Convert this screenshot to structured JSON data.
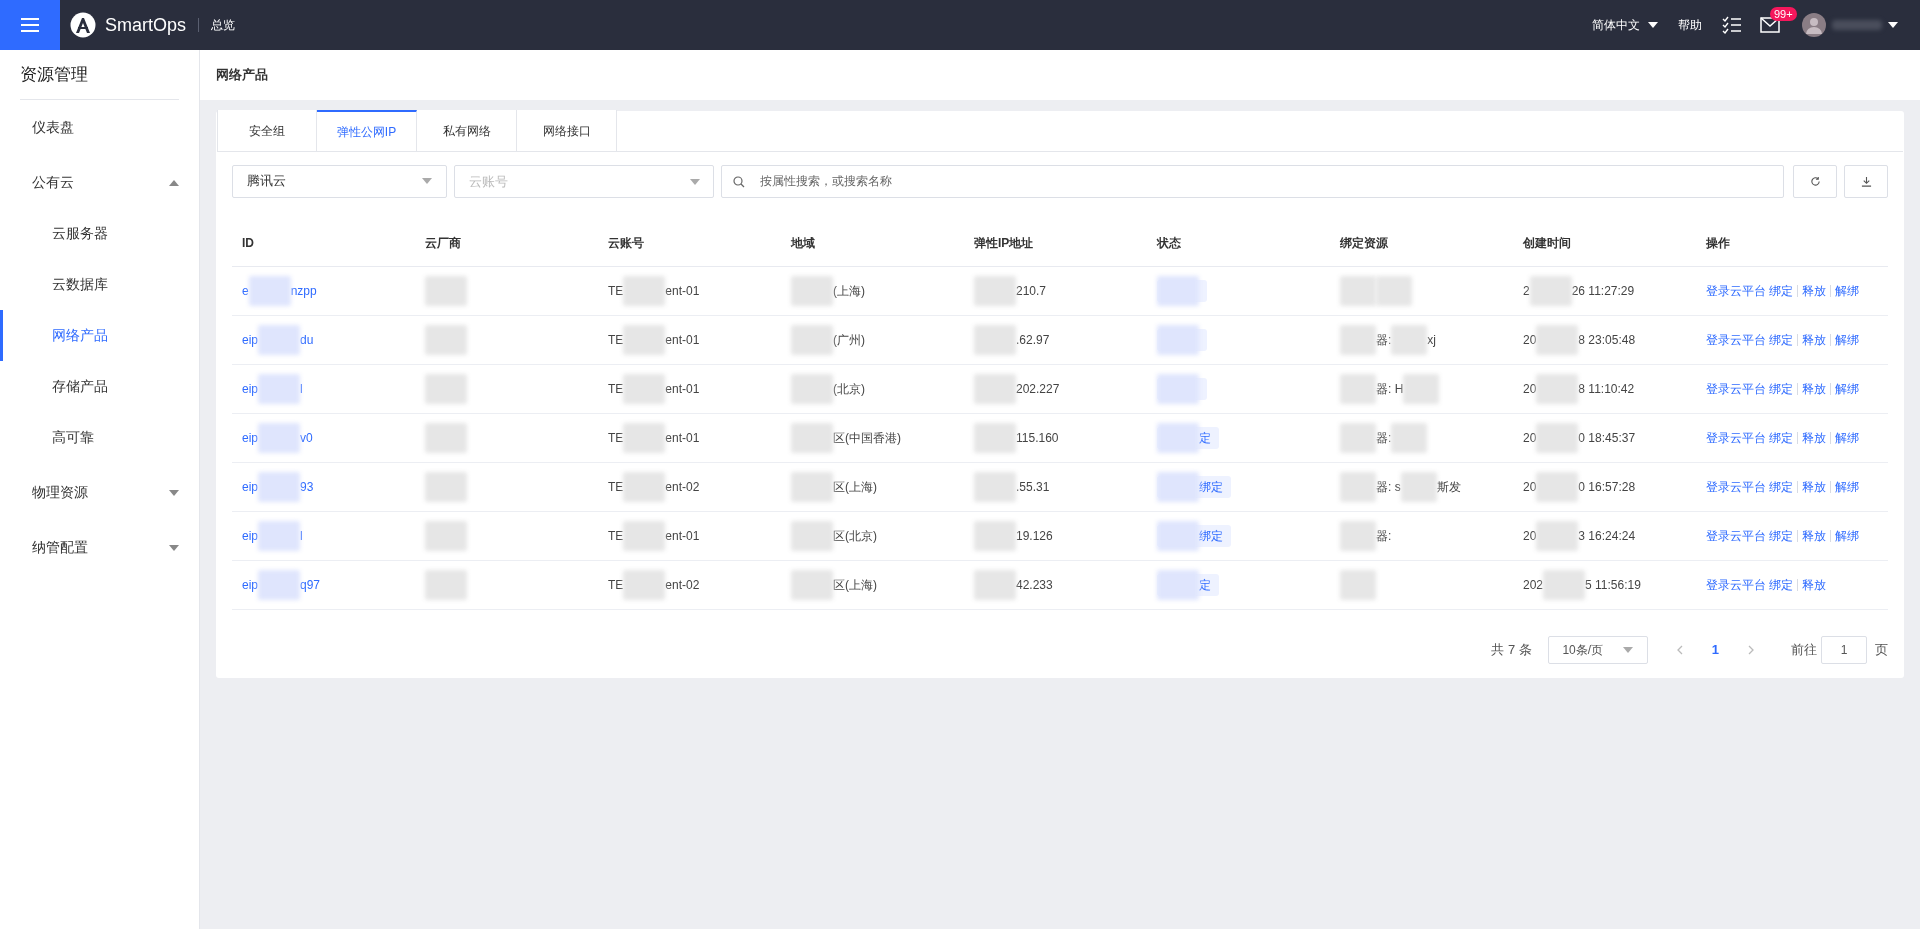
{
  "top_bar": {
    "app_name": "SmartOps",
    "nav": "总览",
    "language": "简体中文",
    "help": "帮助",
    "notification_count": "99+"
  },
  "sidebar": {
    "title": "资源管理",
    "items": [
      {
        "label": "仪表盘",
        "selected": false
      },
      {
        "label": "公有云",
        "selected": false,
        "expanded": true,
        "children": [
          {
            "label": "云服务器",
            "selected": false
          },
          {
            "label": "云数据库",
            "selected": false
          },
          {
            "label": "网络产品",
            "selected": true
          },
          {
            "label": "存储产品",
            "selected": false
          },
          {
            "label": "高可靠",
            "selected": false
          }
        ]
      },
      {
        "label": "物理资源",
        "selected": false,
        "expanded": false
      },
      {
        "label": "纳管配置",
        "selected": false,
        "expanded": false
      }
    ]
  },
  "page_title": "网络产品",
  "tabs": [
    {
      "label": "安全组",
      "selected": false
    },
    {
      "label": "弹性公网IP",
      "selected": true
    },
    {
      "label": "私有网络",
      "selected": false
    },
    {
      "label": "网络接口",
      "selected": false
    }
  ],
  "filters": {
    "vendor": {
      "value": "腾讯云"
    },
    "account": {
      "placeholder": "云账号"
    },
    "search": {
      "placeholder": "按属性搜索，或搜索名称"
    }
  },
  "table": {
    "columns": [
      "ID",
      "云厂商",
      "云账号",
      "地域",
      "弹性IP地址",
      "状态",
      "绑定资源",
      "创建时间",
      "操作"
    ],
    "rows": [
      {
        "cells": [
          [
            {
              "kind": "text",
              "text": "e"
            },
            {
              "kind": "blur"
            },
            {
              "kind": "text",
              "text": "nzpp"
            }
          ],
          [
            {
              "kind": "blur"
            }
          ],
          [
            {
              "kind": "text",
              "text": "TE"
            },
            {
              "kind": "blur"
            },
            {
              "kind": "text",
              "text": "ent-01"
            }
          ],
          [
            {
              "kind": "blur"
            },
            {
              "kind": "text",
              "text": "(上海)"
            }
          ],
          [
            {
              "kind": "blur"
            },
            {
              "kind": "text",
              "text": "210.7"
            }
          ],
          [
            {
              "kind": "blur"
            }
          ],
          [
            {
              "kind": "blur"
            },
            {
              "kind": "blur"
            }
          ],
          [
            {
              "kind": "text",
              "text": "2"
            },
            {
              "kind": "blur"
            },
            {
              "kind": "text",
              "text": "26 11:27:29"
            }
          ]
        ],
        "actions": [
          "登录云平台",
          "绑定",
          "释放",
          "解绑"
        ]
      },
      {
        "cells": [
          [
            {
              "kind": "text",
              "text": "eip"
            },
            {
              "kind": "blur"
            },
            {
              "kind": "text",
              "text": "du"
            }
          ],
          [
            {
              "kind": "blur"
            }
          ],
          [
            {
              "kind": "text",
              "text": "TE"
            },
            {
              "kind": "blur"
            },
            {
              "kind": "text",
              "text": "ent-01"
            }
          ],
          [
            {
              "kind": "blur"
            },
            {
              "kind": "text",
              "text": "(广州)"
            }
          ],
          [
            {
              "kind": "blur"
            },
            {
              "kind": "text",
              "text": ".62.97"
            }
          ],
          [
            {
              "kind": "blur"
            }
          ],
          [
            {
              "kind": "blur"
            },
            {
              "kind": "text",
              "text": "器:"
            },
            {
              "kind": "blur"
            },
            {
              "kind": "text",
              "text": "xj"
            }
          ],
          [
            {
              "kind": "text",
              "text": "20"
            },
            {
              "kind": "blur"
            },
            {
              "kind": "text",
              "text": "8 23:05:48"
            }
          ]
        ],
        "actions": [
          "登录云平台",
          "绑定",
          "释放",
          "解绑"
        ]
      },
      {
        "cells": [
          [
            {
              "kind": "text",
              "text": "eip"
            },
            {
              "kind": "blur"
            },
            {
              "kind": "text",
              "text": "l"
            }
          ],
          [
            {
              "kind": "blur"
            }
          ],
          [
            {
              "kind": "text",
              "text": "TE"
            },
            {
              "kind": "blur"
            },
            {
              "kind": "text",
              "text": "ent-01"
            }
          ],
          [
            {
              "kind": "blur"
            },
            {
              "kind": "text",
              "text": "(北京)"
            }
          ],
          [
            {
              "kind": "blur"
            },
            {
              "kind": "text",
              "text": "202.227"
            }
          ],
          [
            {
              "kind": "blur"
            }
          ],
          [
            {
              "kind": "blur"
            },
            {
              "kind": "text",
              "text": "器: H"
            },
            {
              "kind": "blur"
            }
          ],
          [
            {
              "kind": "text",
              "text": "20"
            },
            {
              "kind": "blur"
            },
            {
              "kind": "text",
              "text": "8 11:10:42"
            }
          ]
        ],
        "actions": [
          "登录云平台",
          "绑定",
          "释放",
          "解绑"
        ]
      },
      {
        "cells": [
          [
            {
              "kind": "text",
              "text": "eip"
            },
            {
              "kind": "blur"
            },
            {
              "kind": "text",
              "text": "v0"
            }
          ],
          [
            {
              "kind": "blur"
            }
          ],
          [
            {
              "kind": "text",
              "text": "TE"
            },
            {
              "kind": "blur"
            },
            {
              "kind": "text",
              "text": "ent-01"
            }
          ],
          [
            {
              "kind": "blur"
            },
            {
              "kind": "text",
              "text": "区(中国香港)"
            }
          ],
          [
            {
              "kind": "blur"
            },
            {
              "kind": "text",
              "text": "115.160"
            }
          ],
          [
            {
              "kind": "blur"
            },
            {
              "kind": "text",
              "text": "定"
            }
          ],
          [
            {
              "kind": "blur"
            },
            {
              "kind": "text",
              "text": "器:"
            },
            {
              "kind": "blur"
            }
          ],
          [
            {
              "kind": "text",
              "text": "20"
            },
            {
              "kind": "blur"
            },
            {
              "kind": "text",
              "text": "0 18:45:37"
            }
          ]
        ],
        "actions": [
          "登录云平台",
          "绑定",
          "释放",
          "解绑"
        ]
      },
      {
        "cells": [
          [
            {
              "kind": "text",
              "text": "eip"
            },
            {
              "kind": "blur"
            },
            {
              "kind": "text",
              "text": "93"
            }
          ],
          [
            {
              "kind": "blur"
            }
          ],
          [
            {
              "kind": "text",
              "text": "TE"
            },
            {
              "kind": "blur"
            },
            {
              "kind": "text",
              "text": "ent-02"
            }
          ],
          [
            {
              "kind": "blur"
            },
            {
              "kind": "text",
              "text": "区(上海)"
            }
          ],
          [
            {
              "kind": "blur"
            },
            {
              "kind": "text",
              "text": ".55.31"
            }
          ],
          [
            {
              "kind": "blur"
            },
            {
              "kind": "text",
              "text": "绑定"
            }
          ],
          [
            {
              "kind": "blur"
            },
            {
              "kind": "text",
              "text": "器: s"
            },
            {
              "kind": "blur"
            },
            {
              "kind": "text",
              "text": "斯"
            },
            {
              "kind": "text",
              "text": "发"
            }
          ],
          [
            {
              "kind": "text",
              "text": "20"
            },
            {
              "kind": "blur"
            },
            {
              "kind": "text",
              "text": "0 16:57:28"
            }
          ]
        ],
        "actions": [
          "登录云平台",
          "绑定",
          "释放",
          "解绑"
        ]
      },
      {
        "cells": [
          [
            {
              "kind": "text",
              "text": "eip"
            },
            {
              "kind": "blur"
            },
            {
              "kind": "text",
              "text": "l"
            }
          ],
          [
            {
              "kind": "blur"
            }
          ],
          [
            {
              "kind": "text",
              "text": "TE"
            },
            {
              "kind": "blur"
            },
            {
              "kind": "text",
              "text": "ent-01"
            }
          ],
          [
            {
              "kind": "blur"
            },
            {
              "kind": "text",
              "text": "区(北京)"
            }
          ],
          [
            {
              "kind": "blur"
            },
            {
              "kind": "text",
              "text": "19.126"
            }
          ],
          [
            {
              "kind": "blur"
            },
            {
              "kind": "text",
              "text": "绑定"
            }
          ],
          [
            {
              "kind": "blur"
            },
            {
              "kind": "text",
              "text": "器:"
            }
          ],
          [
            {
              "kind": "text",
              "text": "20"
            },
            {
              "kind": "blur"
            },
            {
              "kind": "text",
              "text": "3 16:24:24"
            }
          ]
        ],
        "actions": [
          "登录云平台",
          "绑定",
          "释放",
          "解绑"
        ]
      },
      {
        "cells": [
          [
            {
              "kind": "text",
              "text": "eip"
            },
            {
              "kind": "blur"
            },
            {
              "kind": "text",
              "text": "q97"
            }
          ],
          [
            {
              "kind": "blur"
            }
          ],
          [
            {
              "kind": "text",
              "text": "TE"
            },
            {
              "kind": "blur"
            },
            {
              "kind": "text",
              "text": "ent-02"
            }
          ],
          [
            {
              "kind": "blur"
            },
            {
              "kind": "text",
              "text": "区(上海)"
            }
          ],
          [
            {
              "kind": "blur"
            },
            {
              "kind": "text",
              "text": "42.233"
            }
          ],
          [
            {
              "kind": "blur"
            },
            {
              "kind": "text",
              "text": "定"
            }
          ],
          [
            {
              "kind": "blur"
            }
          ],
          [
            {
              "kind": "text",
              "text": "202"
            },
            {
              "kind": "blur"
            },
            {
              "kind": "text",
              "text": "5 11:56:19"
            }
          ]
        ],
        "actions": [
          "登录云平台",
          "绑定",
          "释放"
        ]
      }
    ]
  },
  "pagination": {
    "total": "共 7 条",
    "page_size": "10条/页",
    "pages": [
      {
        "label": "1",
        "selected": true
      }
    ],
    "goto_label": "前往",
    "goto_value": "1",
    "goto_suffix": "页"
  }
}
